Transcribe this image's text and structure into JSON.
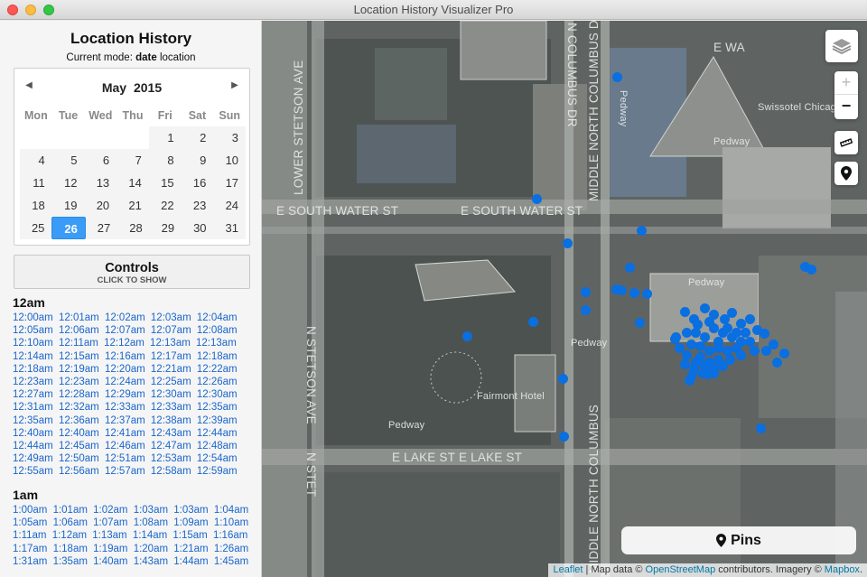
{
  "window": {
    "title": "Location History Visualizer Pro"
  },
  "sidebar": {
    "title": "Location History",
    "mode_prefix": "Current mode: ",
    "mode_bold": "date",
    "mode_suffix": " location",
    "calendar": {
      "month": "May",
      "year": "2015",
      "prev_icon": "caret-left-icon",
      "next_icon": "caret-right-icon",
      "weekdays": [
        "Mon",
        "Tue",
        "Wed",
        "Thu",
        "Fri",
        "Sat",
        "Sun"
      ],
      "weeks": [
        [
          "",
          "",
          "",
          "",
          "1",
          "2",
          "3"
        ],
        [
          "4",
          "5",
          "6",
          "7",
          "8",
          "9",
          "10"
        ],
        [
          "11",
          "12",
          "13",
          "14",
          "15",
          "16",
          "17"
        ],
        [
          "18",
          "19",
          "20",
          "21",
          "22",
          "23",
          "24"
        ],
        [
          "25",
          "26",
          "27",
          "28",
          "29",
          "30",
          "31"
        ]
      ],
      "selected_day": "26"
    },
    "controls": {
      "title": "Controls",
      "subtitle": "CLICK TO SHOW"
    },
    "hours": [
      {
        "label": "12am",
        "times": [
          "12:00am",
          "12:01am",
          "12:02am",
          "12:03am",
          "12:04am",
          "12:05am",
          "12:06am",
          "12:07am",
          "12:07am",
          "12:08am",
          "12:10am",
          "12:11am",
          "12:12am",
          "12:13am",
          "12:13am",
          "12:14am",
          "12:15am",
          "12:16am",
          "12:17am",
          "12:18am",
          "12:18am",
          "12:19am",
          "12:20am",
          "12:21am",
          "12:22am",
          "12:23am",
          "12:23am",
          "12:24am",
          "12:25am",
          "12:26am",
          "12:27am",
          "12:28am",
          "12:29am",
          "12:30am",
          "12:30am",
          "12:31am",
          "12:32am",
          "12:33am",
          "12:33am",
          "12:35am",
          "12:35am",
          "12:36am",
          "12:37am",
          "12:38am",
          "12:39am",
          "12:40am",
          "12:40am",
          "12:41am",
          "12:43am",
          "12:44am",
          "12:44am",
          "12:45am",
          "12:46am",
          "12:47am",
          "12:48am",
          "12:49am",
          "12:50am",
          "12:51am",
          "12:53am",
          "12:54am",
          "12:55am",
          "12:56am",
          "12:57am",
          "12:58am",
          "12:59am"
        ]
      },
      {
        "label": "1am",
        "times": [
          "1:00am",
          "1:01am",
          "1:02am",
          "1:03am",
          "1:03am",
          "1:04am",
          "1:05am",
          "1:06am",
          "1:07am",
          "1:08am",
          "1:09am",
          "1:10am",
          "1:11am",
          "1:12am",
          "1:13am",
          "1:14am",
          "1:15am",
          "1:16am",
          "1:17am",
          "1:18am",
          "1:19am",
          "1:20am",
          "1:21am",
          "1:26am",
          "1:31am",
          "1:35am",
          "1:40am",
          "1:43am",
          "1:44am",
          "1:45am"
        ]
      }
    ]
  },
  "map": {
    "labels": {
      "lower_stetson": "LOWER STETSON AVE",
      "south_water_1": "E SOUTH WATER ST",
      "south_water_2": "E SOUTH WATER ST",
      "n_columbus_1": "N COLUMBUS DR",
      "middle_north_columbus_1": "MIDDLE NORTH COLUMBUS D",
      "middle_north_columbus_2": "MIDDLE NORTH COLUMBUS",
      "n_stetson_1": "N STETSON AVE",
      "n_stetson_2": "N STET",
      "lake_1": "E LAKE ST",
      "lake_2": "E LAKE ST",
      "pedway_1": "Pedway",
      "pedway_2": "Pedway",
      "pedway_3": "Pedway",
      "pedway_4": "Pedway",
      "pedway_5": "Pedway",
      "swissotel": "Swissotel Chicago",
      "fairmont": "Fairmont Hotel",
      "e_wacker": "E WA"
    },
    "controls": {
      "layers_icon": "layers-icon",
      "zoom_in": "+",
      "zoom_out": "−",
      "measure_icon": "ruler-icon",
      "pin_icon": "map-marker-icon"
    },
    "pins_button": "Pins",
    "attribution": {
      "leaflet": "Leaflet",
      "sep1": " | Map data © ",
      "osm": "OpenStreetMap",
      "mid": " contributors. Imagery © ",
      "mapbox": "Mapbox",
      "end": "."
    },
    "marker_color": "#0a6fe0"
  }
}
